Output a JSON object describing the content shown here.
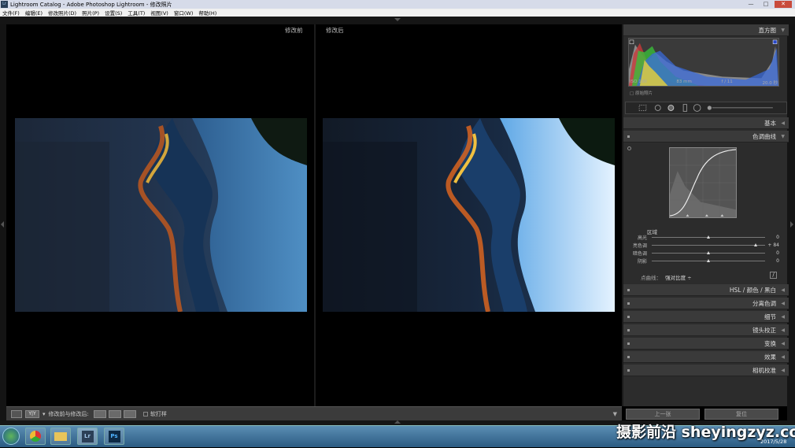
{
  "window": {
    "title": "Lightroom Catalog - Adobe Photoshop Lightroom - 修改照片",
    "app_icon": "Lr"
  },
  "menu": [
    "文件(F)",
    "编辑(E)",
    "修改照片(D)",
    "照片(P)",
    "设置(S)",
    "工具(T)",
    "视图(V)",
    "窗口(W)",
    "帮助(H)"
  ],
  "viewer": {
    "before_label": "修改前",
    "after_label": "修改后"
  },
  "histogram": {
    "title": "直方图",
    "iso": "ISO 100",
    "focal": "83 mm",
    "aperture": "f / 11",
    "shutter": "20.0 秒",
    "original_photo": "原始照片"
  },
  "panels": {
    "basic": "基本",
    "tone_curve": "色调曲线",
    "hsl": "HSL",
    "color": "颜色",
    "bw": "黑白",
    "split_toning": "分离色调",
    "detail": "细节",
    "lens": "镜头校正",
    "transform": "变换",
    "effects": "效果",
    "calibration": "相机校准"
  },
  "tone_curve": {
    "region_label": "区域",
    "sliders": [
      {
        "label": "高光",
        "value": "0",
        "pos": 0.5
      },
      {
        "label": "亮色调",
        "value": "+ 84",
        "pos": 0.92
      },
      {
        "label": "暗色调",
        "value": "0",
        "pos": 0.5
      },
      {
        "label": "阴影",
        "value": "0",
        "pos": 0.5
      }
    ],
    "point_curve_label": "点曲线：",
    "point_curve_value": "强对比度 ÷"
  },
  "toolbar": {
    "yy_label": "Y|Y",
    "compare_label": "修改前与修改后:",
    "soft_proof": "软打样"
  },
  "nav": {
    "prev": "上一张",
    "reset": "复位"
  },
  "taskbar": {
    "lr_label": "Lr",
    "ps_label": "Ps",
    "date": "2017/5/28"
  },
  "watermark": "摄影前沿 sheyingzyz.com",
  "colors": {
    "panel_bg": "#2c2c2c",
    "header_bg": "#3a3a3a",
    "taskbar": "#2b5b82"
  }
}
